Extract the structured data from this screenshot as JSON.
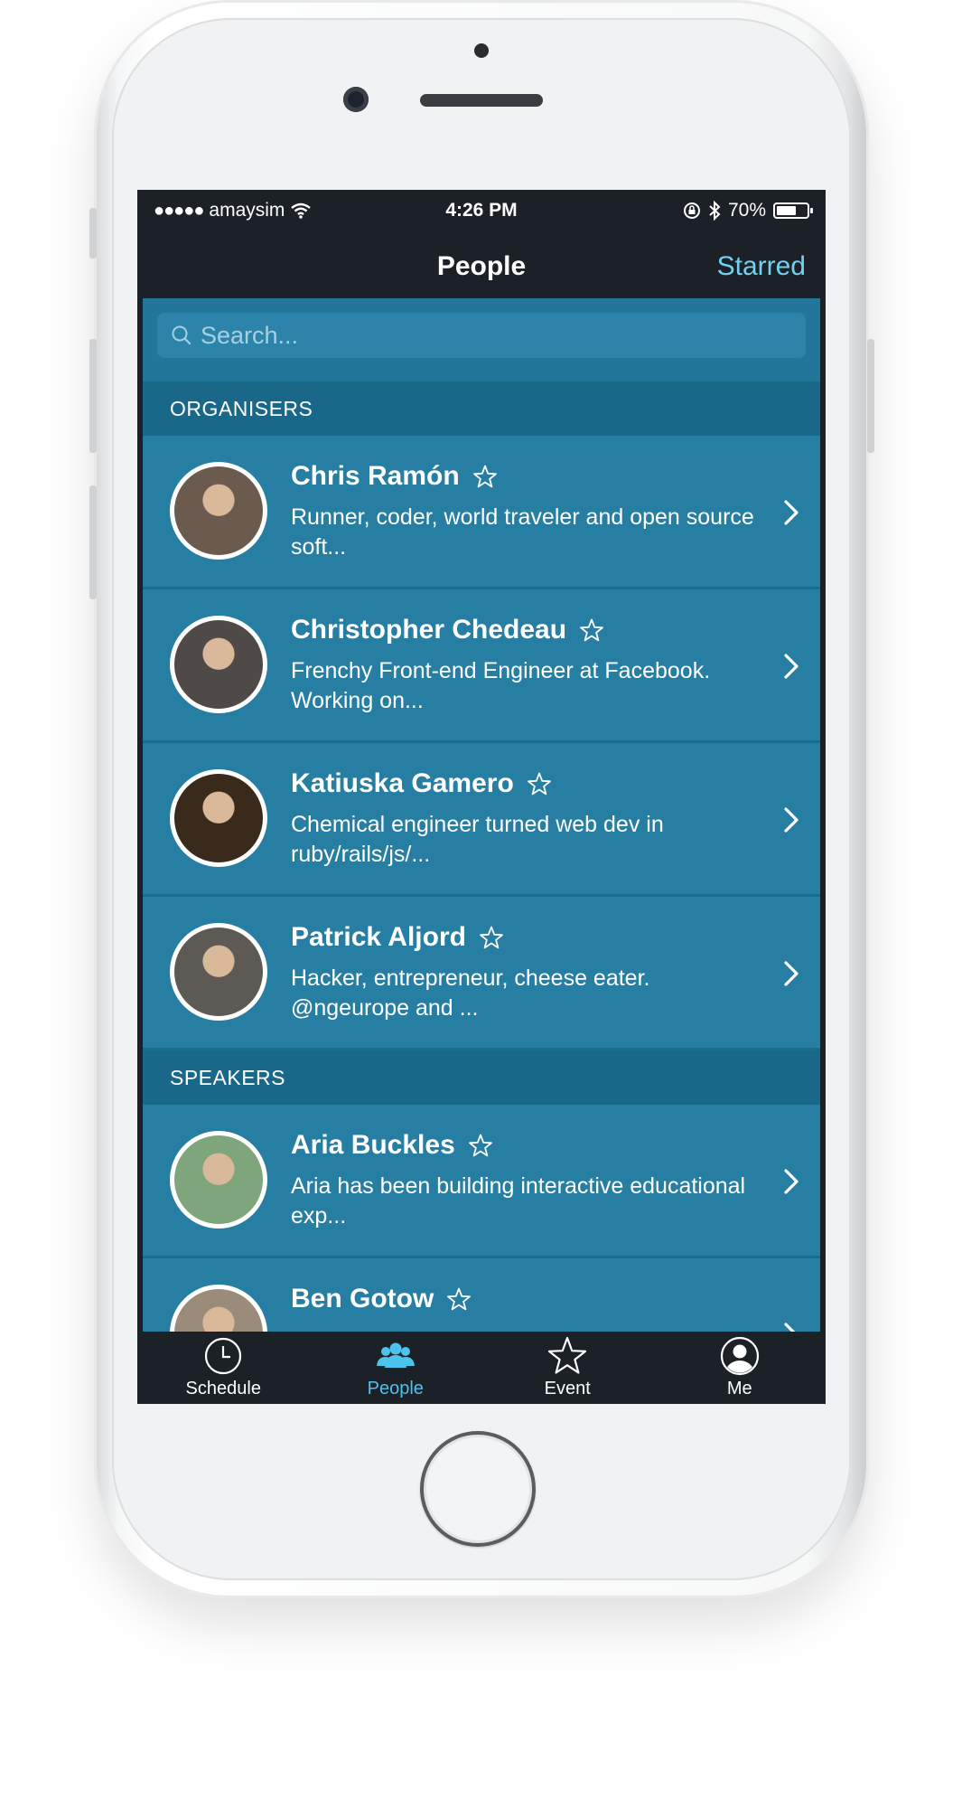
{
  "status_bar": {
    "carrier": "amaysim",
    "signal_dots": "●●●●●",
    "time": "4:26 PM",
    "battery_text": "70%",
    "battery_level": 0.7
  },
  "nav": {
    "title": "People",
    "right_button": "Starred"
  },
  "search": {
    "placeholder": "Search...",
    "value": ""
  },
  "sections": [
    {
      "title": "ORGANISERS",
      "people": [
        {
          "name": "Chris Ramón",
          "bio": "Runner, coder, world traveler and open source soft...",
          "avatar_color": "#6b5b4e"
        },
        {
          "name": "Christopher Chedeau",
          "bio": "Frenchy Front-end Engineer at Facebook. Working on...",
          "avatar_color": "#4f4a48"
        },
        {
          "name": "Katiuska Gamero",
          "bio": "Chemical engineer turned web dev in ruby/rails/js/...",
          "avatar_color": "#3a2a1c"
        },
        {
          "name": "Patrick Aljord",
          "bio": "Hacker, entrepreneur, cheese eater. @ngeurope and ...",
          "avatar_color": "#5d5a55"
        }
      ]
    },
    {
      "title": "SPEAKERS",
      "people": [
        {
          "name": "Aria Buckles",
          "bio": "Aria has been building interactive educational exp...",
          "avatar_color": "#7fa57c"
        },
        {
          "name": "Ben Gotow",
          "bio": "",
          "avatar_color": "#9a8b7a"
        }
      ]
    }
  ],
  "tabs": [
    {
      "label": "Schedule",
      "icon": "clock-icon",
      "active": false
    },
    {
      "label": "People",
      "icon": "people-icon",
      "active": true
    },
    {
      "label": "Event",
      "icon": "star-icon",
      "active": false
    },
    {
      "label": "Me",
      "icon": "user-icon",
      "active": false
    }
  ],
  "colors": {
    "accent": "#4cc3ec",
    "row_bg": "#277ea3",
    "section_bg": "#196789",
    "bar_bg": "#1c2027"
  }
}
